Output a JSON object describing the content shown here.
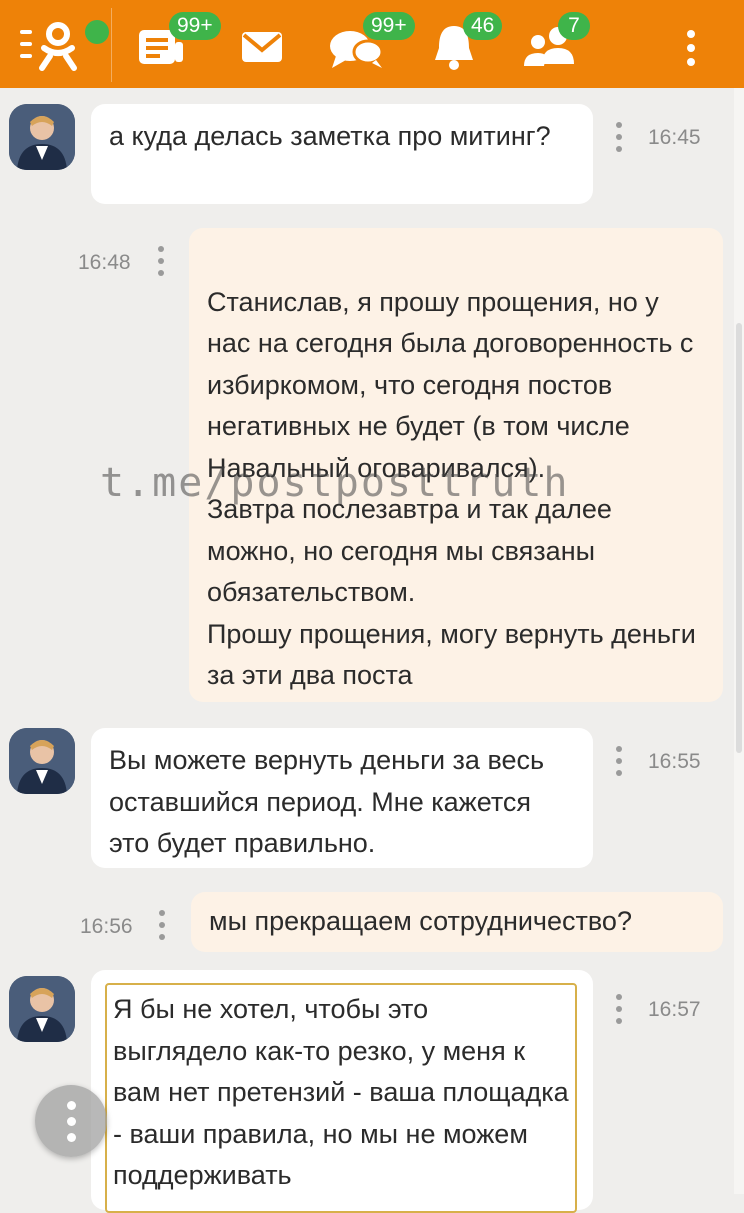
{
  "topbar": {
    "menu_icon": "ok-logo-menu-icon",
    "badges": {
      "feed": "99+",
      "discussions": "99+",
      "notifications": "46",
      "friends": "7"
    },
    "colors": {
      "bar": "#ee8208",
      "badge": "#3fb44a"
    }
  },
  "messages": [
    {
      "author": "other",
      "text": "а куда делась заметка про митинг?",
      "time": "16:45"
    },
    {
      "author": "me",
      "text": "Станислав, я прошу прощения, но у нас на сегодня была договоренность с избиркомом, что сегодня постов негативных не будет (в том числе Навальный оговаривался).\nЗавтра послезавтра и так далее можно, но сегодня мы связаны обязательством.\nПрошу прощения, могу вернуть деньги за эти два поста",
      "time": "16:48"
    },
    {
      "author": "other",
      "text": "Вы можете вернуть деньги за весь оставшийся период. Мне кажется это будет правильно.",
      "time": "16:55"
    },
    {
      "author": "me",
      "text": "мы прекращаем сотрудничество?",
      "time": "16:56"
    },
    {
      "author": "other",
      "text": "Я бы не хотел, чтобы это выглядело как-то резко, у меня к вам нет претензий - ваша площадка - ваши правила, но мы не можем поддерживать",
      "time": "16:57"
    }
  ],
  "watermark": "t.me/postposttruth"
}
